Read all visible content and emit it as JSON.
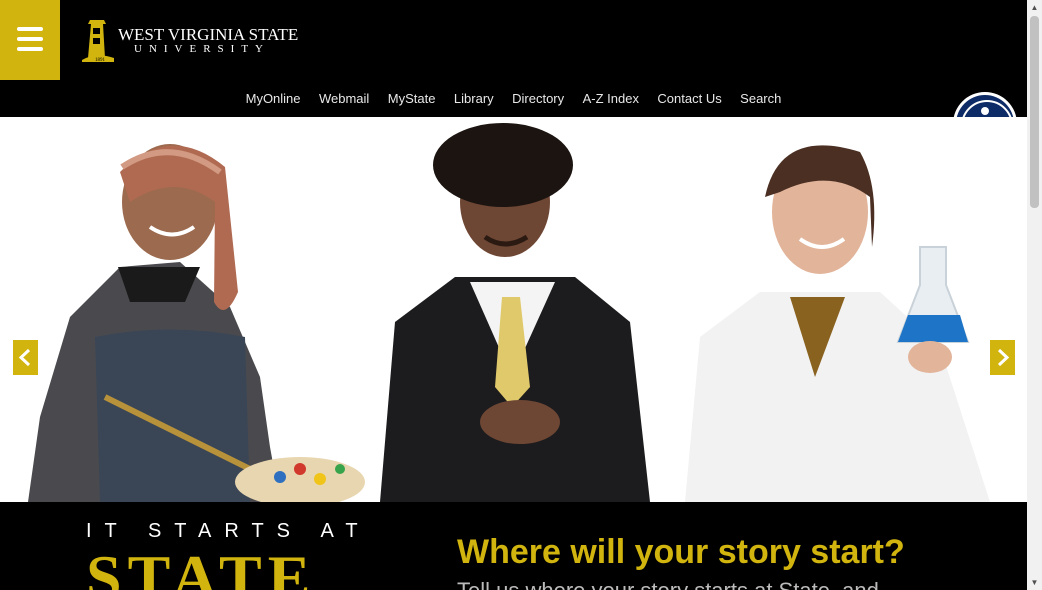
{
  "header": {
    "logo": {
      "name": "WEST VIRGINIA STATE",
      "sub": "UNIVERSITY",
      "year": "1891"
    },
    "nav": [
      "MyOnline",
      "Webmail",
      "MyState",
      "Library",
      "Directory",
      "A-Z Index",
      "Contact Us",
      "Search"
    ]
  },
  "hero": {
    "people": [
      "artist-with-palette",
      "student-in-suit",
      "scientist-with-flask"
    ]
  },
  "band": {
    "kicker": "IT STARTS AT",
    "big": "STATE",
    "headline": "Where will your story start?",
    "tagline": "Tell us where your story starts at State, and"
  },
  "colors": {
    "gold": "#d1b40e",
    "black": "#000000",
    "a11y_blue": "#0d2b66"
  }
}
